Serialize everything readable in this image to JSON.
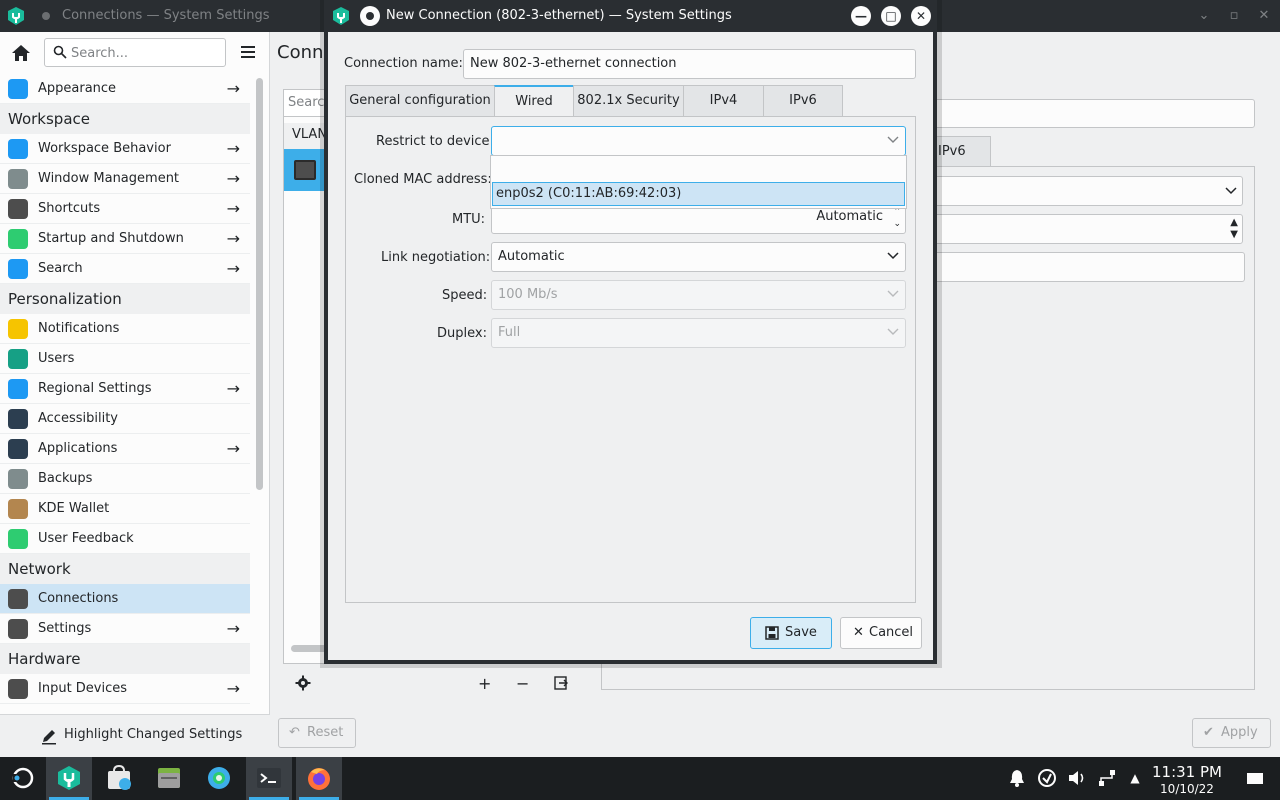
{
  "background_window": {
    "title": "Connections — System Settings",
    "search_placeholder": "Search...",
    "page_title": "Conne",
    "list_search_placeholder": "Search",
    "list_header": "VLAN",
    "right_tab_label": "IPv6",
    "reset_label": "Reset",
    "apply_label": "Apply",
    "highlight_label": "Highlight Changed Settings"
  },
  "sidebar": {
    "items": [
      {
        "type": "item",
        "label": "Appearance",
        "arrow": true,
        "icon": "appearance-icon",
        "color": "#1d99f3"
      },
      {
        "type": "category",
        "label": "Workspace"
      },
      {
        "type": "item",
        "label": "Workspace Behavior",
        "arrow": true,
        "icon": "workspace-behavior-icon",
        "color": "#1d99f3"
      },
      {
        "type": "item",
        "label": "Window Management",
        "arrow": true,
        "icon": "window-management-icon",
        "color": "#7f8c8d"
      },
      {
        "type": "item",
        "label": "Shortcuts",
        "arrow": true,
        "icon": "keyboard-icon",
        "color": "#4d4d4d"
      },
      {
        "type": "item",
        "label": "Startup and Shutdown",
        "arrow": true,
        "icon": "rocket-icon",
        "color": "#2ecc71"
      },
      {
        "type": "item",
        "label": "Search",
        "arrow": true,
        "icon": "search-icon",
        "color": "#1d99f3"
      },
      {
        "type": "category",
        "label": "Personalization"
      },
      {
        "type": "item",
        "label": "Notifications",
        "arrow": false,
        "icon": "bell-icon",
        "color": "#f6c400"
      },
      {
        "type": "item",
        "label": "Users",
        "arrow": false,
        "icon": "users-icon",
        "color": "#16a085"
      },
      {
        "type": "item",
        "label": "Regional Settings",
        "arrow": true,
        "icon": "regional-icon",
        "color": "#1d99f3"
      },
      {
        "type": "item",
        "label": "Accessibility",
        "arrow": false,
        "icon": "accessibility-icon",
        "color": "#2c3e50"
      },
      {
        "type": "item",
        "label": "Applications",
        "arrow": true,
        "icon": "applications-icon",
        "color": "#2c3e50"
      },
      {
        "type": "item",
        "label": "Backups",
        "arrow": false,
        "icon": "backups-icon",
        "color": "#7f8c8d"
      },
      {
        "type": "item",
        "label": "KDE Wallet",
        "arrow": false,
        "icon": "wallet-icon",
        "color": "#b3864f"
      },
      {
        "type": "item",
        "label": "User Feedback",
        "arrow": false,
        "icon": "feedback-icon",
        "color": "#2ecc71"
      },
      {
        "type": "category",
        "label": "Network"
      },
      {
        "type": "item",
        "label": "Connections",
        "arrow": false,
        "icon": "network-connections-icon",
        "color": "#4d4d4d",
        "selected": true
      },
      {
        "type": "item",
        "label": "Settings",
        "arrow": true,
        "icon": "network-settings-icon",
        "color": "#4d4d4d"
      },
      {
        "type": "category",
        "label": "Hardware"
      },
      {
        "type": "item",
        "label": "Input Devices",
        "arrow": true,
        "icon": "mouse-icon",
        "color": "#4d4d4d"
      }
    ]
  },
  "dialog": {
    "title": "New Connection (802-3-ethernet) — System Settings",
    "connection_name_label": "Connection name:",
    "connection_name_value": "New 802-3-ethernet connection",
    "tabs": [
      "General configuration",
      "Wired",
      "802.1x Security",
      "IPv4",
      "IPv6"
    ],
    "active_tab": "Wired",
    "fields": {
      "restrict_label": "Restrict to device:",
      "restrict_value": "",
      "restrict_options": [
        "",
        "enp0s2 (C0:11:AB:69:42:03)"
      ],
      "cloned_mac_label": "Cloned MAC address:",
      "mtu_label": "MTU:",
      "mtu_value": "Automatic",
      "link_neg_label": "Link negotiation:",
      "link_neg_value": "Automatic",
      "speed_label": "Speed:",
      "speed_value": "100 Mb/s",
      "duplex_label": "Duplex:",
      "duplex_value": "Full"
    },
    "save_label": "Save",
    "cancel_label": "Cancel"
  },
  "taskbar": {
    "apps": [
      "plasma-launcher-icon",
      "system-settings-icon",
      "discover-store-icon",
      "file-manager-icon",
      "settings-gear-icon",
      "terminal-icon",
      "firefox-icon"
    ],
    "time": "11:31 PM",
    "date": "10/10/22"
  },
  "colors": {
    "accent": "#3daee9",
    "selection": "#cde4f5",
    "titlebar": "#2a2e32",
    "taskbar": "#1b1e20"
  }
}
